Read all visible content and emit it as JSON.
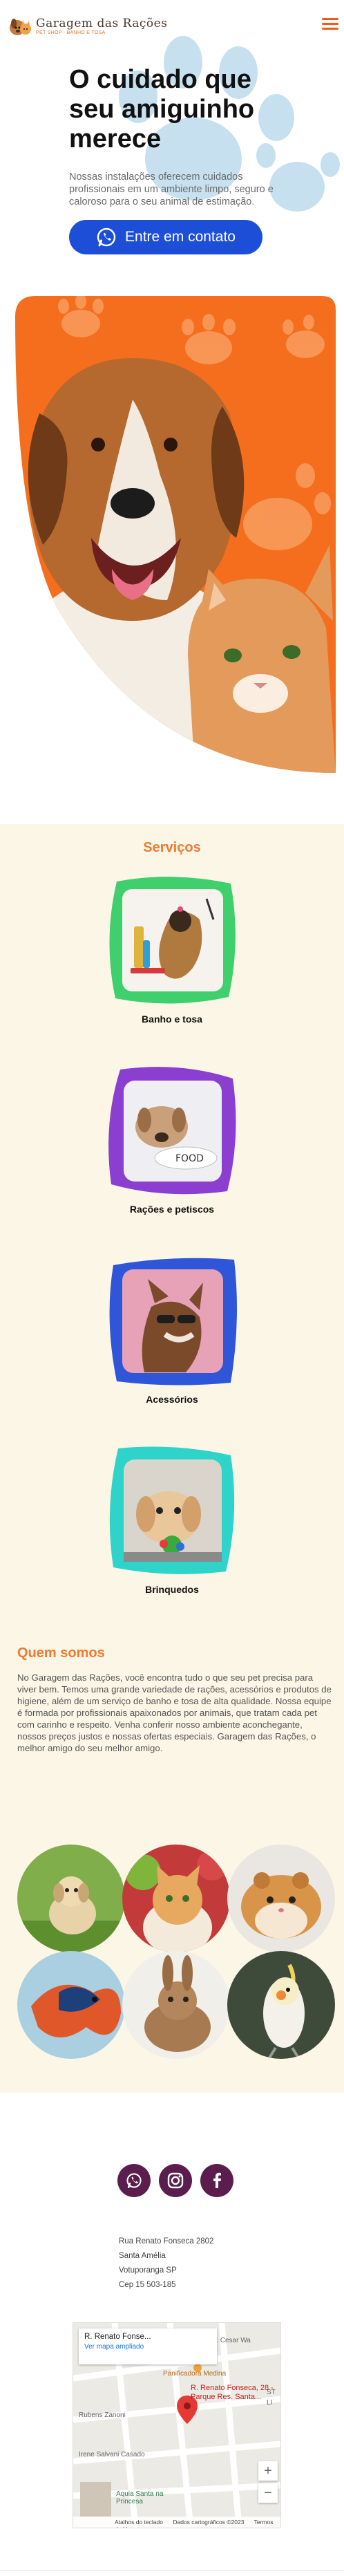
{
  "header": {
    "brand_name": "Garagem das Rações",
    "brand_tagline": "PET SHOP · BANHO E TOSA",
    "logo_icon": "dog-cat-logo",
    "menu_icon": "hamburger-menu-icon"
  },
  "hero": {
    "title": "O cuidado que seu amiguinho merece",
    "description": "Nossas instalações oferecem cuidados profissionais em um ambiente limpo, seguro e caloroso para o seu animal de estimação.",
    "cta_label": "Entre em contato",
    "cta_icon": "whatsapp-icon",
    "photo_subject": "dog and cat"
  },
  "services": {
    "title": "Serviços",
    "items": [
      {
        "label": "Banho e tosa",
        "frame_color": "#3fcf6d",
        "photo": "groomed yorkshire terrier"
      },
      {
        "label": "Rações e petiscos",
        "frame_color": "#8a3fd1",
        "photo": "puppy with food bowl"
      },
      {
        "label": "Acessórios",
        "frame_color": "#2f55d9",
        "photo": "dog with sunglasses"
      },
      {
        "label": "Brinquedos",
        "frame_color": "#2ed3c9",
        "photo": "puppy with toy"
      }
    ]
  },
  "about": {
    "title": "Quem somos",
    "text": "No Garagem das Rações, você encontra tudo o que seu pet precisa para viver bem. Temos uma grande variedade de rações, acessórios e produtos de higiene, além de um serviço de banho e tosa de alta qualidade. Nossa equipe é formada por profissionais apaixonados por animais, que tratam cada pet com carinho e respeito. Venha conferir nosso ambiente aconchegante, nossos preços justos e nossas ofertas especiais. Garagem das Rações, o melhor amigo do seu melhor amigo.",
    "gallery": [
      "puppy",
      "cat",
      "hamster",
      "betta fish",
      "rabbit",
      "cockatiel"
    ]
  },
  "footer": {
    "social": [
      {
        "name": "whatsapp",
        "icon": "whatsapp-icon",
        "color": "#5b1d4d"
      },
      {
        "name": "instagram",
        "icon": "instagram-icon",
        "color": "#5b1d4d"
      },
      {
        "name": "facebook",
        "icon": "facebook-icon",
        "color": "#5b1d4d"
      }
    ],
    "address": {
      "line1": "Rua Renato Fonseca 2802",
      "line2": "Santa Amélia",
      "line3": "Votuporanga SP",
      "line4": "Cep 15 503-185"
    },
    "map": {
      "card_title": "R. Renato Fonse...",
      "card_link": "Ver mapa ampliado",
      "pin_label": "R. Renato Fonseca, 28 - Parque Res. Santa...",
      "places": [
        "R. Cesar Wa",
        "Panificadora Medina",
        "Rubens Zanoni",
        "Irene Salvani Casado",
        "Aquia Santa na Princesa",
        "ST",
        "LI"
      ],
      "zoom_in": "+",
      "zoom_out": "−",
      "footer_keys": "Atalhos do teclado",
      "footer_data": "Dados cartográficos ©2023",
      "footer_terms": "Termos de Uso"
    }
  }
}
